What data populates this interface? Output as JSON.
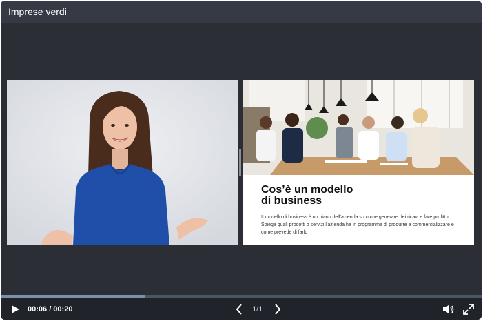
{
  "window": {
    "title": "Imprese verdi"
  },
  "slide": {
    "title": "Cos’è un modello\ndi business",
    "body": "Il modello di business è un piano dell’azienda su come generare dei ricavi e fare profitto. Spiega quali prodotti o servizi l’azienda ha in programma di produrre e commercializzare e come prevede di farlo"
  },
  "playback": {
    "current_time": "00:06",
    "duration": "00:20",
    "time_display": "00:06 / 00:20",
    "progress": 0.3
  },
  "pager": {
    "current": "1",
    "separator": " / ",
    "total": "1"
  },
  "icons": {
    "play": "play-icon",
    "prev": "chevron-left-icon",
    "next": "chevron-right-icon",
    "volume": "volume-icon",
    "fullscreen": "fullscreen-icon"
  },
  "colors": {
    "background": "#2b2e34",
    "titlebar": "#353a44",
    "controls": "#20232a",
    "shirt": "#1f4fa8"
  }
}
